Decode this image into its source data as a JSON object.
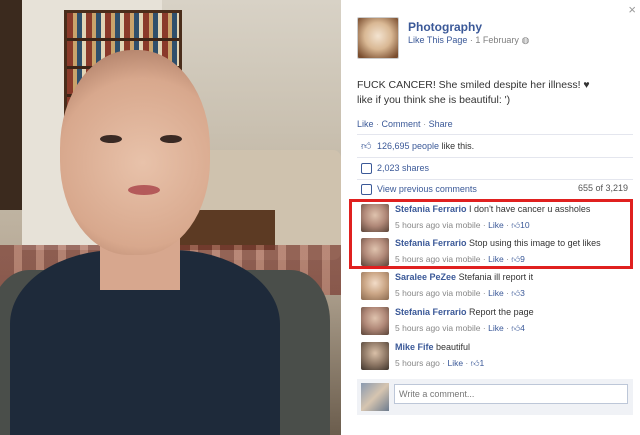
{
  "post": {
    "close_icon": "×",
    "page_name": "Photography",
    "like_page": "Like This Page",
    "date": "1 February",
    "caption_line1": "FUCK CANCER! She smiled despite her illness! ♥",
    "caption_line2": "like if you think she is beautiful: ')",
    "actions": {
      "like": "Like",
      "comment": "Comment",
      "share": "Share"
    },
    "likes_count": "126,695 people",
    "likes_suffix": "like this.",
    "shares": "2,023 shares",
    "view_previous": "View previous comments",
    "comment_count": "655 of 3,219",
    "comments": [
      {
        "author": "Stefania Ferrario",
        "text": "I don't have cancer u assholes",
        "time": "5 hours ago via mobile",
        "like": "Like",
        "likes": "10"
      },
      {
        "author": "Stefania Ferrario",
        "text": "Stop using this image to get likes",
        "time": "5 hours ago via mobile",
        "like": "Like",
        "likes": "9"
      },
      {
        "author": "Saralee PeZee",
        "text": "Stefania ill report it",
        "time": "5 hours ago via mobile",
        "like": "Like",
        "likes": "3"
      },
      {
        "author": "Stefania Ferrario",
        "text": "Report the page",
        "time": "5 hours ago via mobile",
        "like": "Like",
        "likes": "4"
      },
      {
        "author": "Mike Fife",
        "text": "beautiful",
        "time": "5 hours ago",
        "like": "Like",
        "likes": "1"
      }
    ],
    "comment_placeholder": "Write a comment..."
  },
  "colors": {
    "link": "#3b5998",
    "highlight": "#e0201f"
  },
  "icons": [
    "close-icon",
    "thumbs-up-icon",
    "share-icon",
    "comment-bubble-icon",
    "globe-icon"
  ]
}
